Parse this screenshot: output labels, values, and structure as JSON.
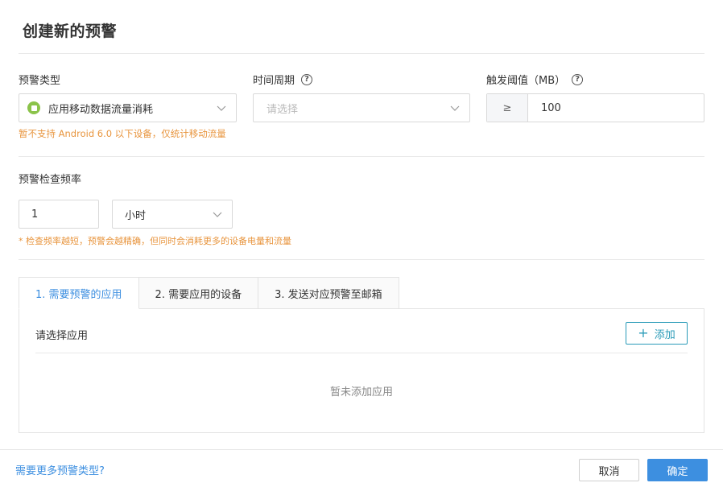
{
  "dialog": {
    "title": "创建新的预警"
  },
  "alert_type": {
    "label": "预警类型",
    "selected": "应用移动数据流量消耗",
    "hint": "暂不支持 Android 6.0 以下设备，仅统计移动流量"
  },
  "time_period": {
    "label": "时间周期",
    "placeholder": "请选择"
  },
  "threshold": {
    "label": "触发阈值（MB）",
    "operator": "≥",
    "value": "100"
  },
  "check_frequency": {
    "label": "预警检查频率",
    "value": "1",
    "unit": "小时",
    "hint": "* 检查频率越短，预警会越精确，但同时会消耗更多的设备电量和流量"
  },
  "tabs": [
    {
      "label": "1. 需要预警的应用",
      "active": true
    },
    {
      "label": "2. 需要应用的设备",
      "active": false
    },
    {
      "label": "3. 发送对应预警至邮箱",
      "active": false
    }
  ],
  "apps_panel": {
    "title": "请选择应用",
    "add_label": "添加",
    "empty_text": "暂未添加应用"
  },
  "footer": {
    "more_link": "需要更多预警类型?",
    "cancel_label": "取消",
    "confirm_label": "确定"
  },
  "colors": {
    "accent": "#3d8fe0",
    "hint": "#e8953e",
    "add_button": "#2a9bb8",
    "app_icon": "#8bc34a"
  },
  "icons": {
    "help": "question-circle-icon",
    "chevron": "chevron-down-icon",
    "app": "app-icon",
    "plus": "plus-icon"
  }
}
